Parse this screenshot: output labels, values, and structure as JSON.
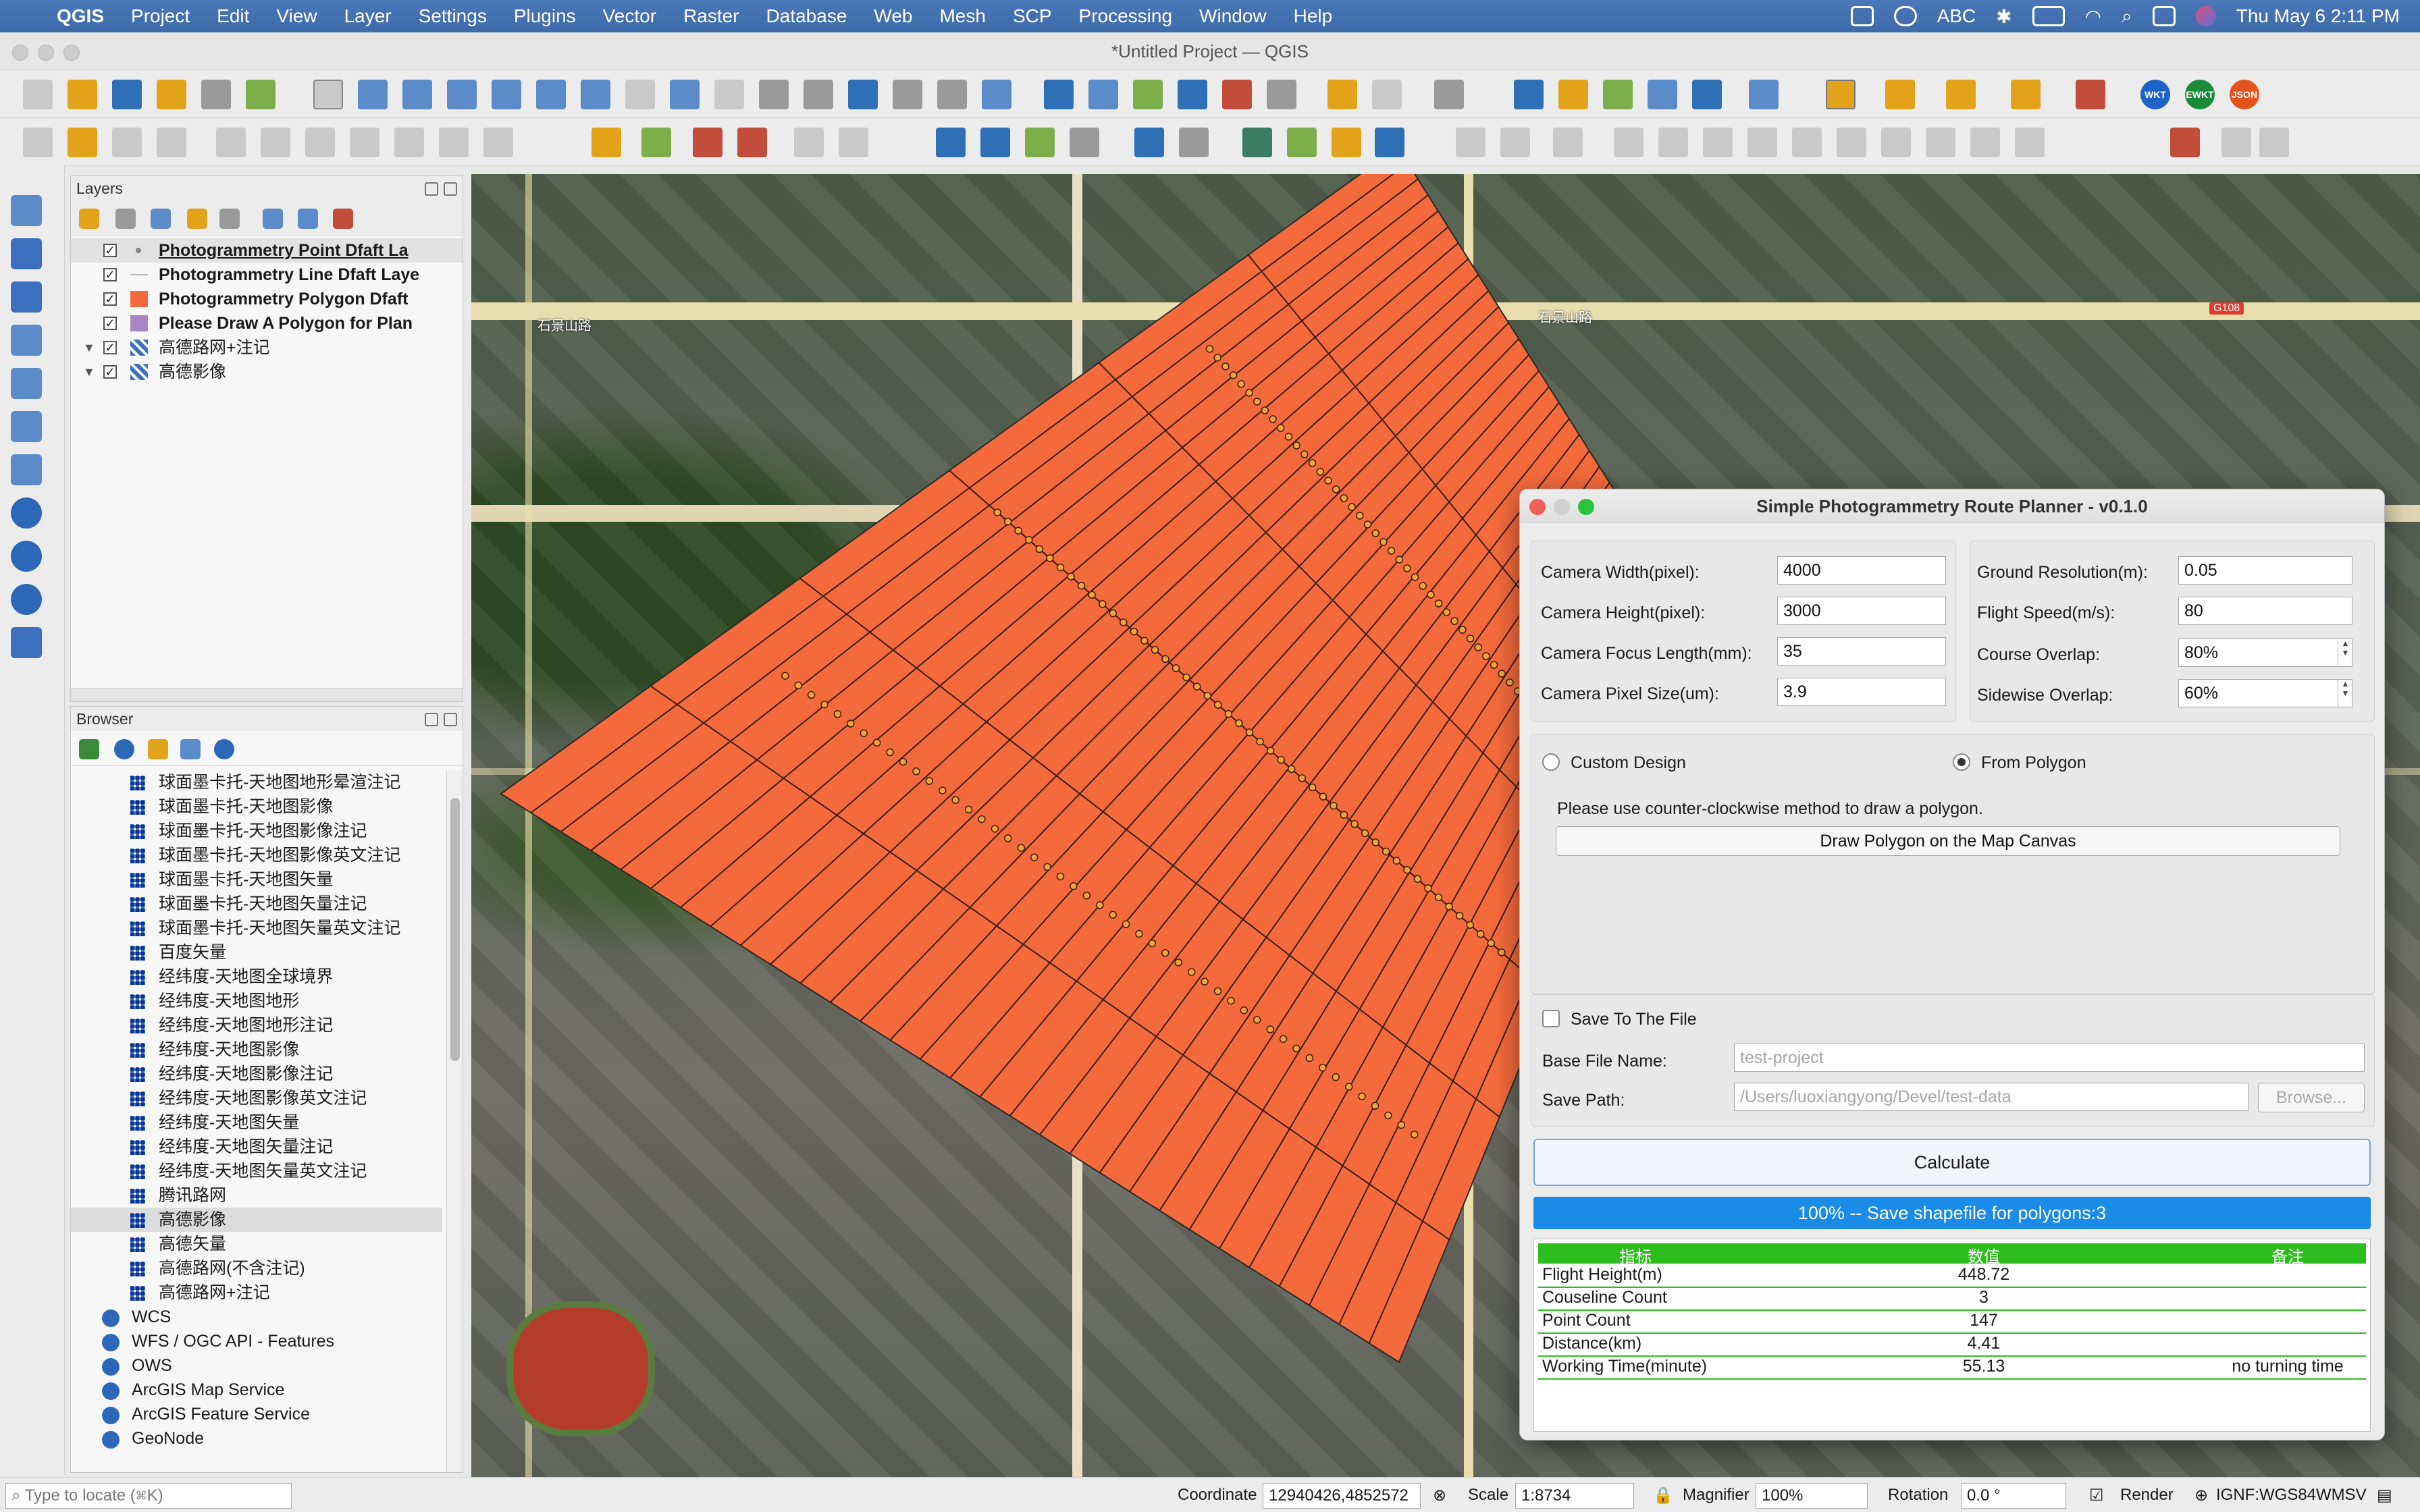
{
  "menubar": {
    "app": "QGIS",
    "items": [
      "Project",
      "Edit",
      "View",
      "Layer",
      "Settings",
      "Plugins",
      "Vector",
      "Raster",
      "Database",
      "Web",
      "Mesh",
      "SCP",
      "Processing",
      "Window",
      "Help"
    ],
    "input_source": "ABC",
    "clock": "Thu May 6  2:11 PM"
  },
  "window": {
    "title": "*Untitled Project — QGIS"
  },
  "toolbar_pills": {
    "wkt": "WKT",
    "ewkt": "EWKT",
    "json": "JSON"
  },
  "layers_panel": {
    "title": "Layers",
    "layers": [
      {
        "name": "Photogrammetry Point Dfaft La",
        "checked": true,
        "bold": true,
        "color": "#c7cbd1"
      },
      {
        "name": "Photogrammetry Line Dfaft Laye",
        "checked": true,
        "bold": true,
        "color": "#d8d8d8"
      },
      {
        "name": "Photogrammetry Polygon Dfaft",
        "checked": true,
        "bold": true,
        "color": "#f46a3c"
      },
      {
        "name": "Please Draw A Polygon for Plan",
        "checked": true,
        "bold": true,
        "color": "#a486c4"
      },
      {
        "name": "高德路网+注记",
        "checked": true,
        "bold": false,
        "color": "#3c6fc0"
      },
      {
        "name": "高德影像",
        "checked": true,
        "bold": false,
        "color": "#3c6fc0"
      }
    ]
  },
  "browser_panel": {
    "title": "Browser",
    "items": [
      "球面墨卡托-天地图地形晕渲注记",
      "球面墨卡托-天地图影像",
      "球面墨卡托-天地图影像注记",
      "球面墨卡托-天地图影像英文注记",
      "球面墨卡托-天地图矢量",
      "球面墨卡托-天地图矢量注记",
      "球面墨卡托-天地图矢量英文注记",
      "百度矢量",
      "经纬度-天地图全球境界",
      "经纬度-天地图地形",
      "经纬度-天地图地形注记",
      "经纬度-天地图影像",
      "经纬度-天地图影像注记",
      "经纬度-天地图影像英文注记",
      "经纬度-天地图矢量",
      "经纬度-天地图矢量注记",
      "经纬度-天地图矢量英文注记",
      "腾讯路网",
      "高德影像",
      "高德矢量",
      "高德路网(不含注记)",
      "高德路网+注记"
    ],
    "selected_index": 18,
    "services": [
      "WCS",
      "WFS / OGC API - Features",
      "OWS",
      "ArcGIS Map Service",
      "ArcGIS Feature Service",
      "GeoNode"
    ]
  },
  "map": {
    "road_label_left": "石景山路",
    "road_label_right": "石景山路",
    "route_badge": "G108"
  },
  "dialog": {
    "title": "Simple Photogrammetry Route Planner - v0.1.0",
    "camera": [
      {
        "label": "Camera Width(pixel):",
        "value": "4000"
      },
      {
        "label": "Camera Height(pixel):",
        "value": "3000"
      },
      {
        "label": "Camera Focus Length(mm):",
        "value": "35"
      },
      {
        "label": "Camera Pixel Size(um):",
        "value": "3.9"
      }
    ],
    "flight": [
      {
        "label": "Ground Resolution(m):",
        "value": "0.05"
      },
      {
        "label": "Flight Speed(m/s):",
        "value": "80"
      },
      {
        "label": "Course Overlap:",
        "value": "80%"
      },
      {
        "label": "Sidewise Overlap:",
        "value": "60%"
      }
    ],
    "mode_custom": "Custom Design",
    "mode_polygon": "From Polygon",
    "hint": "Please use counter-clockwise method to draw a polygon.",
    "draw_button": "Draw Polygon on the Map Canvas",
    "save_to_file": "Save To The File",
    "base_file_label": "Base File Name:",
    "base_file_placeholder": "test-project",
    "save_path_label": "Save Path:",
    "save_path_placeholder": "/Users/luoxiangyong/Devel/test-data",
    "browse_button": "Browse...",
    "calculate_button": "Calculate",
    "progress_text": "100% -- Save shapefile for polygons:3",
    "progress": 1.0,
    "results_header": {
      "c1": "指标",
      "c2": "数值",
      "c3": "备注"
    },
    "results": [
      {
        "name": "Flight Height(m)",
        "value": "448.72",
        "note": ""
      },
      {
        "name": "Couseline Count",
        "value": "3",
        "note": ""
      },
      {
        "name": "Point Count",
        "value": "147",
        "note": ""
      },
      {
        "name": "Distance(km)",
        "value": "4.41",
        "note": ""
      },
      {
        "name": "Working Time(minute)",
        "value": "55.13",
        "note": "no turning time"
      }
    ]
  },
  "statusbar": {
    "locate_placeholder": "Type to locate (⌘K)",
    "coordinate_label": "Coordinate",
    "coordinate": "12940426,4852572",
    "scale_label": "Scale",
    "scale": "1:8734",
    "magnifier_label": "Magnifier",
    "magnifier": "100%",
    "rotation_label": "Rotation",
    "rotation": "0.0 °",
    "render_label": "Render",
    "crs": "IGNF:WGS84WMSV"
  }
}
